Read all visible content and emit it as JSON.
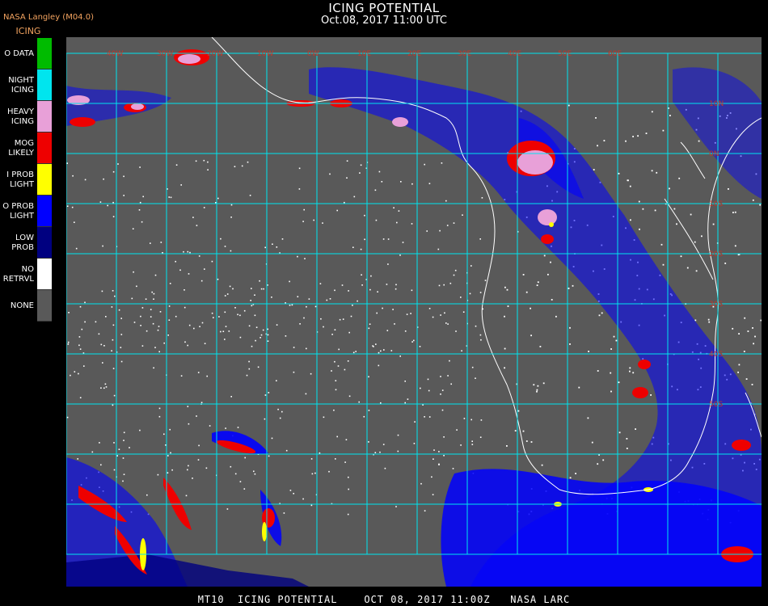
{
  "header": {
    "credit": "NASA Langley (M04.0)",
    "product": "ICING",
    "title": "ICING POTENTIAL",
    "subtitle": "Oct.08, 2017 11:00 UTC"
  },
  "legend": [
    {
      "label": "O DATA",
      "color": "#00bb00"
    },
    {
      "label": "NIGHT\nICING",
      "color": "#00e5ee"
    },
    {
      "label": "HEAVY\nICING",
      "color": "#e8a0d8"
    },
    {
      "label": "MOG\nLIKELY",
      "color": "#ee0000"
    },
    {
      "label": "I PROB\nLIGHT",
      "color": "#ffff00"
    },
    {
      "label": "O PROB\nLIGHT",
      "color": "#0000ff"
    },
    {
      "label": "LOW\nPROB",
      "color": "#000080"
    },
    {
      "label": "NO\nRETRVL",
      "color": "#ffffff"
    },
    {
      "label": "NONE",
      "color": "#595959"
    }
  ],
  "map": {
    "grid_color": "#00e5ee",
    "coastline_color": "#ffffff",
    "lon_labels": [
      "40W",
      "30W",
      "20W",
      "10W",
      "0W",
      "10E",
      "20E",
      "30E",
      "40E",
      "50E",
      "60E"
    ],
    "lat_labels": [
      "10N",
      "0N",
      "10S",
      "20S",
      "30S",
      "40S",
      "50S"
    ]
  },
  "footer": "MT10  ICING POTENTIAL    OCT 08, 2017 11:00Z   NASA LARC"
}
